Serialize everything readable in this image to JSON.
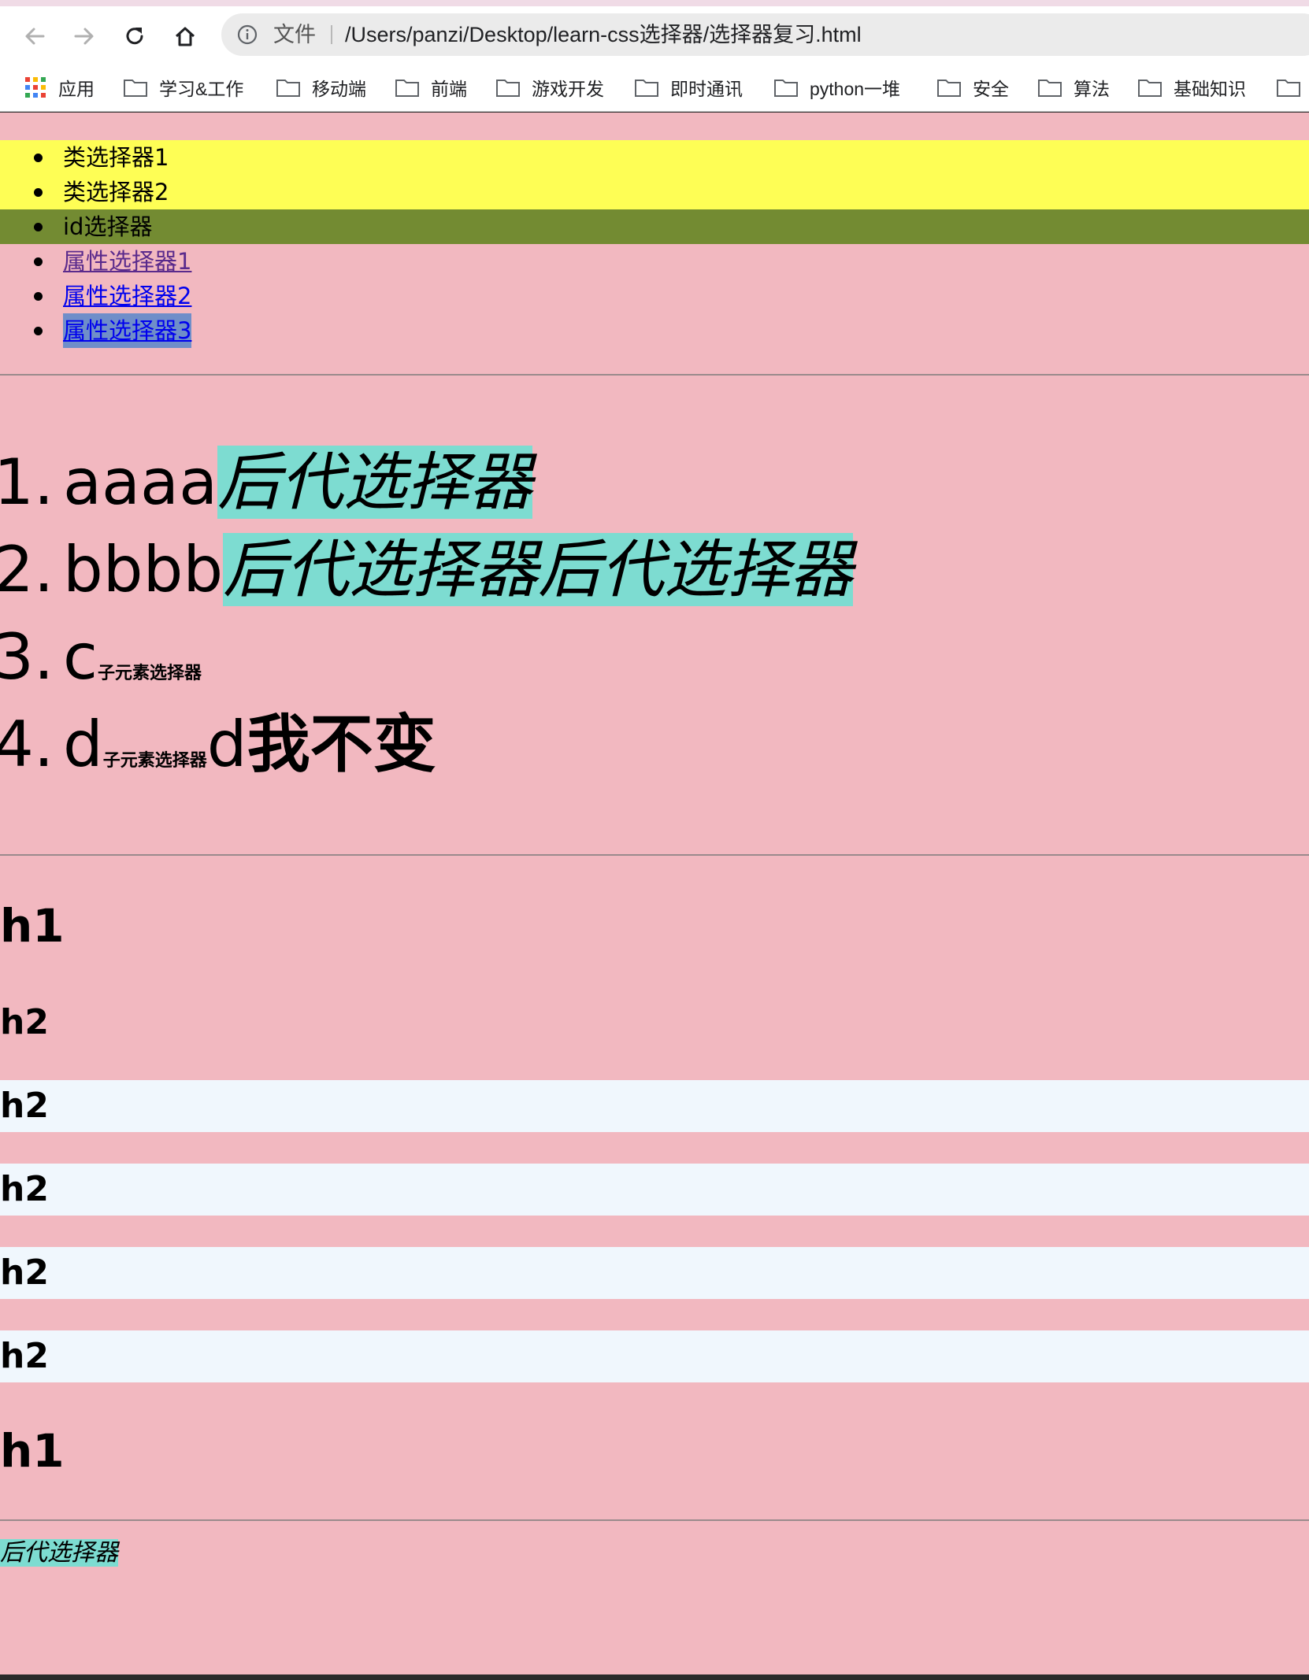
{
  "browser": {
    "omnibox": {
      "security_label": "文件",
      "url": "/Users/panzi/Desktop/learn-css选择器/选择器复习.html"
    },
    "bookmarks": [
      {
        "label": "应用",
        "icon": "apps-grid-icon"
      },
      {
        "label": "学习&工作",
        "icon": "folder-icon"
      },
      {
        "label": "移动端",
        "icon": "folder-icon"
      },
      {
        "label": "前端",
        "icon": "folder-icon"
      },
      {
        "label": "游戏开发",
        "icon": "folder-icon"
      },
      {
        "label": "即时通讯",
        "icon": "folder-icon"
      },
      {
        "label": "python一堆",
        "icon": "folder-icon"
      },
      {
        "label": "安全",
        "icon": "folder-icon"
      },
      {
        "label": "算法",
        "icon": "folder-icon"
      },
      {
        "label": "基础知识",
        "icon": "folder-icon"
      }
    ]
  },
  "page": {
    "ul_items": [
      {
        "text": "类选择器1",
        "style": "class",
        "bg": "#fefe55"
      },
      {
        "text": "类选择器2",
        "style": "class",
        "bg": "#fefe55"
      },
      {
        "text": "id选择器",
        "style": "id",
        "bg": "#738b32"
      },
      {
        "text": "属性选择器1",
        "style": "visited-link",
        "color": "#5a2a8c"
      },
      {
        "text": "属性选择器2",
        "style": "link",
        "color": "#0000ee"
      },
      {
        "text": "属性选择器3",
        "style": "link-highlight",
        "color": "#0000ee",
        "bg": "#6f8ec9"
      }
    ],
    "ol_items": [
      {
        "num": "1.",
        "plain": "aaaa",
        "em": "后代选择器"
      },
      {
        "num": "2.",
        "plain": "bbbb",
        "em": "后代选择器后代选择器"
      },
      {
        "num": "3.",
        "plain": "c",
        "small": "子元素选择器"
      },
      {
        "num": "4.",
        "plain": "d",
        "small": "子元素选择器",
        "plain2": "d",
        "bold": "我不变"
      }
    ],
    "headings": [
      {
        "tag": "h1",
        "text": "h1"
      },
      {
        "tag": "h2",
        "text": "h2"
      },
      {
        "tag": "h2",
        "text": "h2"
      },
      {
        "tag": "h2",
        "text": "h2"
      },
      {
        "tag": "h2",
        "text": "h2"
      },
      {
        "tag": "h2",
        "text": "h2"
      },
      {
        "tag": "h1",
        "text": "h1"
      }
    ],
    "footer_em": "后代选择器",
    "colors": {
      "page_bg": "#f2b8c0",
      "highlight_teal": "#7ddcd1",
      "alt_row": "#f0f7fd"
    }
  }
}
